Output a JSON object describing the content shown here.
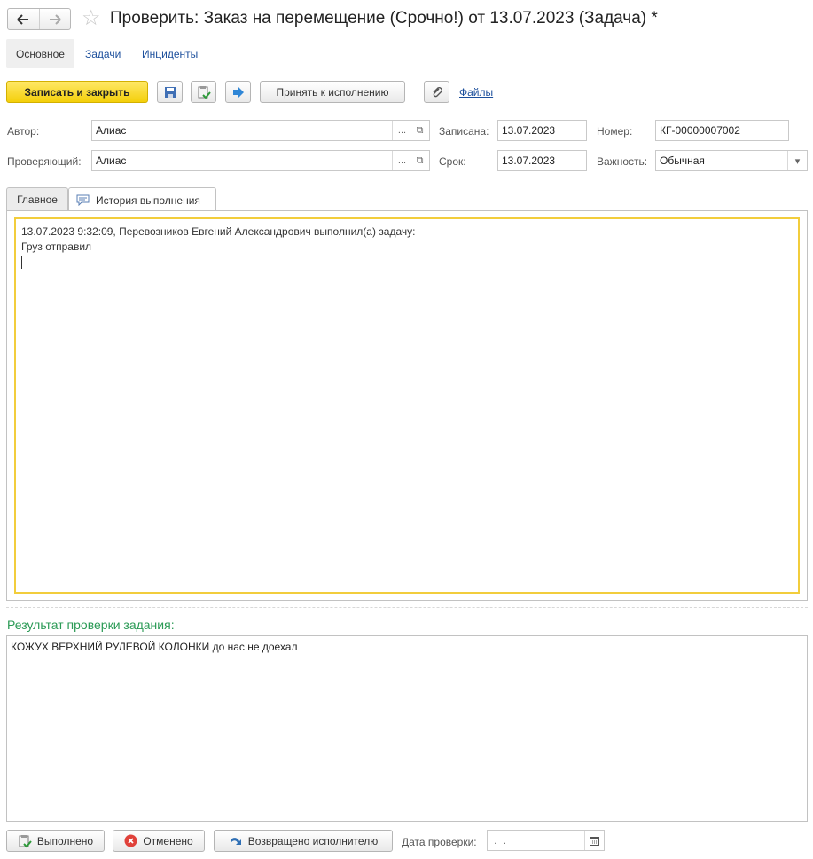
{
  "window": {
    "title": "Проверить: Заказ на перемещение (Срочно!) от 13.07.2023 (Задача) *"
  },
  "nav": {
    "back_icon": "arrow-left-icon",
    "forward_icon": "arrow-right-icon",
    "favorite_icon": "star-icon"
  },
  "top_tabs": [
    {
      "label": "Основное",
      "active": true
    },
    {
      "label": "Задачи",
      "active": false
    },
    {
      "label": "Инциденты",
      "active": false
    }
  ],
  "toolbar": {
    "save_close_label": "Записать и закрыть",
    "accept_label": "Принять к исполнению",
    "files_label": "Файлы"
  },
  "form": {
    "author_label": "Автор:",
    "author_value": "Алиас",
    "reviewer_label": "Проверяющий:",
    "reviewer_value": "Алиас",
    "recorded_label": "Записана:",
    "recorded_value": "13.07.2023",
    "deadline_label": "Срок:",
    "deadline_value": "13.07.2023",
    "number_label": "Номер:",
    "number_value": "КГ-00000007002",
    "importance_label": "Важность:",
    "importance_value": "Обычная",
    "choose_button": "..."
  },
  "inner_tabs": [
    {
      "label": "Главное",
      "active": false
    },
    {
      "label": "История выполнения",
      "active": true
    }
  ],
  "history": {
    "line1": "13.07.2023 9:32:09, Перевозников Евгений Александрович выполнил(а) задачу:",
    "line2": "Груз отправил"
  },
  "result": {
    "section_label": "Результат проверки задания:",
    "text": "КОЖУХ ВЕРХНИЙ РУЛЕВОЙ КОЛОНКИ до нас не доехал"
  },
  "bottom": {
    "done_label": "Выполнено",
    "cancelled_label": "Отменено",
    "returned_label": "Возвращено исполнителю",
    "check_date_label": "Дата проверки:",
    "check_date_value": " .  ."
  },
  "colors": {
    "accent_yellow": "#f4cf0a",
    "link_blue": "#1c4f9c",
    "section_green": "#2a9a55",
    "focus_border": "#f2cd3c"
  }
}
